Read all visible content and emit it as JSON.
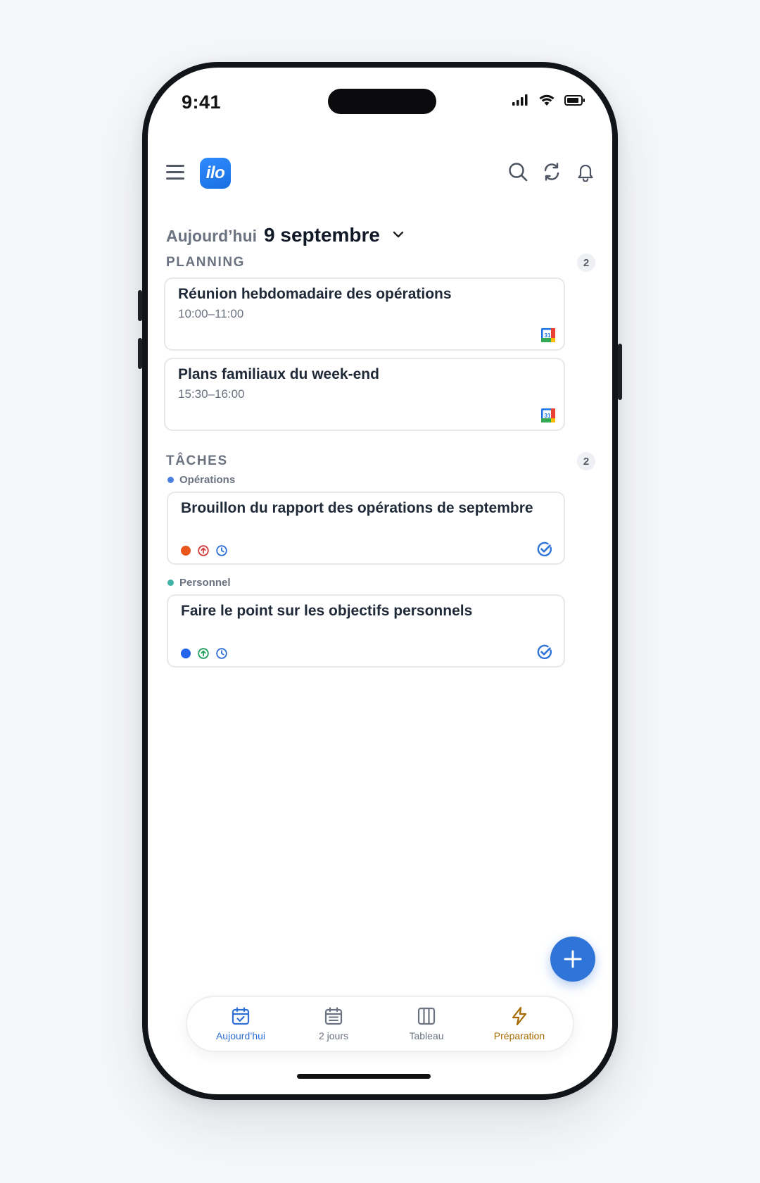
{
  "status": {
    "time": "9:41"
  },
  "header": {
    "logo_text": "ilo"
  },
  "date": {
    "prefix": "Aujourd’hui",
    "value": "9 septembre"
  },
  "planning": {
    "title": "PLANNING",
    "count": "2",
    "events": [
      {
        "title": "Réunion hebdomadaire des opérations",
        "time": "10:00–11:00"
      },
      {
        "title": "Plans familiaux du week-end",
        "time": "15:30–16:00"
      }
    ]
  },
  "tasks": {
    "title": "TÂCHES",
    "count": "2",
    "groups": [
      {
        "label": "Opérations",
        "dot_color": "#4a7fe0",
        "task": {
          "title": "Brouillon du rapport des opérations de septembre",
          "priority_color": "#e8561a",
          "arrow_color": "#d23a3a"
        }
      },
      {
        "label": "Personnel",
        "dot_color": "#3fb2a4",
        "task": {
          "title": "Faire le point sur les objectifs personnels",
          "priority_color": "#2563eb",
          "arrow_color": "#1f9d5a"
        }
      }
    ]
  },
  "tabbar": {
    "items": [
      {
        "label": "Aujourd’hui",
        "icon": "calendar-check-icon",
        "color": "#2f6fd6"
      },
      {
        "label": "2 jours",
        "icon": "calendar-list-icon",
        "color": "#6b7280"
      },
      {
        "label": "Tableau",
        "icon": "columns-icon",
        "color": "#6b7280"
      },
      {
        "label": "Préparation",
        "icon": "lightning-icon",
        "color": "#a66a00"
      }
    ]
  },
  "colors": {
    "accent": "#2f74d8",
    "card_border": "#e6e8ec"
  }
}
